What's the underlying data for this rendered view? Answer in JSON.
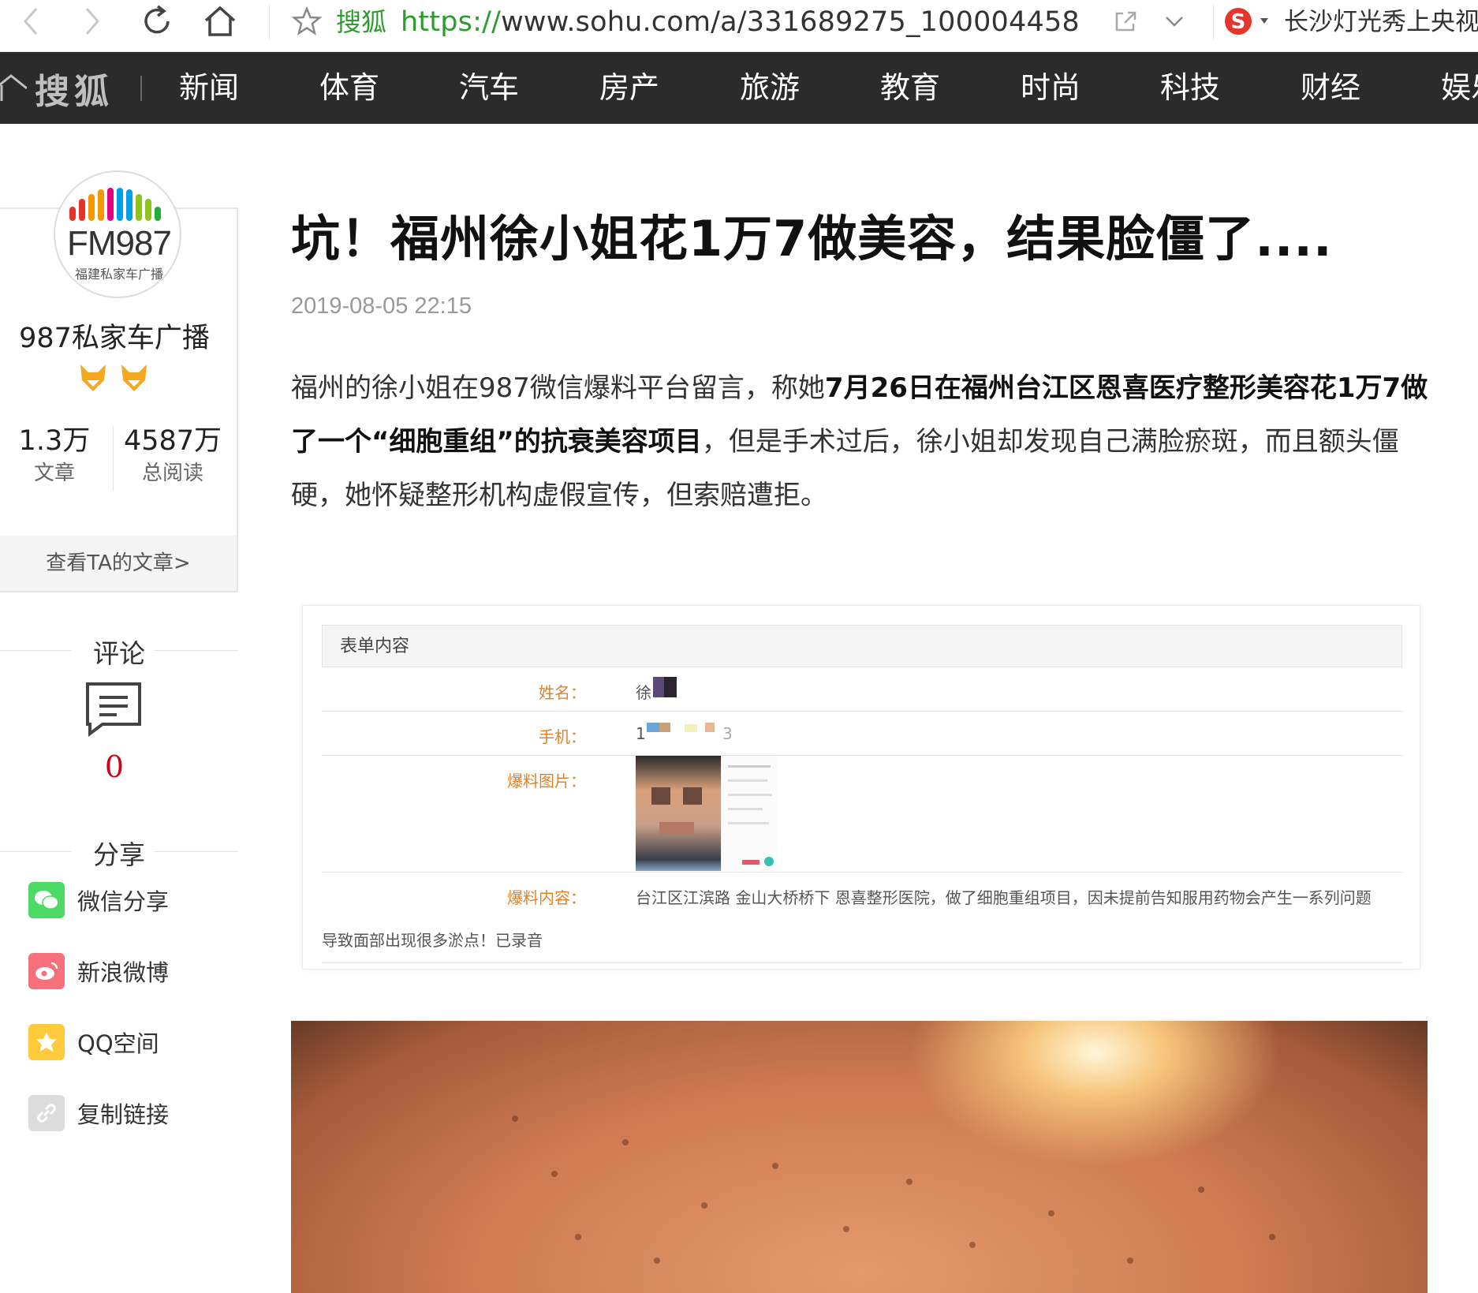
{
  "browser": {
    "site_name": "搜狐",
    "url_protocol": "https://",
    "url_rest": "www.sohu.com/a/331689275_100004458",
    "search_hint": "长沙灯光秀上央视"
  },
  "nav": {
    "logo_text": "搜狐",
    "items": [
      "新闻",
      "体育",
      "汽车",
      "房产",
      "旅游",
      "教育",
      "时尚",
      "科技",
      "财经",
      "娱乐"
    ]
  },
  "author": {
    "avatar_text": "FM987",
    "avatar_sub": "福建私家车广播",
    "name": "987私家车广播",
    "articles_count": "1.3万",
    "articles_label": "文章",
    "reads_count": "4587万",
    "reads_label": "总阅读",
    "view_articles": "查看TA的文章>"
  },
  "comments": {
    "title": "评论",
    "count": "0"
  },
  "share": {
    "title": "分享",
    "items": [
      {
        "label": "微信分享",
        "icon": "wechat-icon",
        "color": "#4cd964"
      },
      {
        "label": "新浪微博",
        "icon": "weibo-icon",
        "color": "#f5707a"
      },
      {
        "label": "QQ空间",
        "icon": "qzone-icon",
        "color": "#ffcb3d"
      },
      {
        "label": "复制链接",
        "icon": "link-icon",
        "color": "#dcdcdc"
      }
    ]
  },
  "article": {
    "title": "坑！福州徐小姐花1万7做美容，结果脸僵了....",
    "date": "2019-08-05 22:15",
    "para_1": "福州的徐小姐在987微信爆料平台留言，称她",
    "para_bold": "7月26日在福州台江区恩喜医疗整形美容花1万7做了一个“细胞重组”的抗衰美容项目",
    "para_2": "，但是手术过后，徐小姐却发现自己满脸瘀斑，而且额头僵硬，她怀疑整形机构虚假宣传，但索赔遭拒。"
  },
  "form": {
    "heading": "表单内容",
    "name_label": "姓名：",
    "name_value": "徐",
    "phone_label": "手机：",
    "phone_value_start": "1",
    "phone_value_end": "3",
    "image_label": "爆料图片：",
    "content_label": "爆料内容：",
    "content_value": "台江区江滨路 金山大桥桥下 恩喜整形医院，做了细胞重组项目，因未提前告知服用药物会产生一系列问题",
    "content_continued": "导致面部出现很多淤点！已录音"
  },
  "colors": {
    "nav_bg": "#2b2b2b",
    "accent_green": "#2a9d2a",
    "comment_red": "#d0021b",
    "form_label": "#e0822a"
  }
}
